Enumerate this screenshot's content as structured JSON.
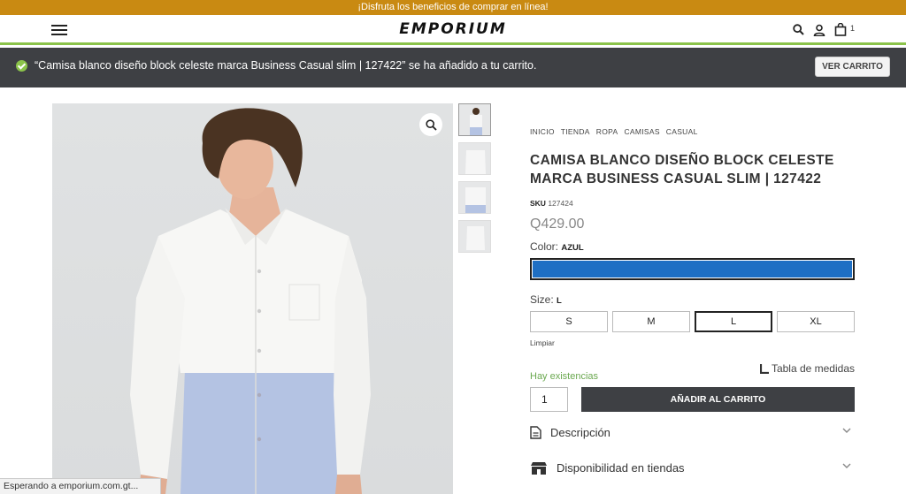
{
  "promo": {
    "text": "¡Disfruta los beneficios de comprar en línea!"
  },
  "header": {
    "logo": "EMPORIUM",
    "cart_count": "1"
  },
  "notice": {
    "message": "“Camisa blanco diseño block celeste marca Business Casual slim | 127422” se ha añadido a tu carrito.",
    "button_label": "VER CARRITO"
  },
  "breadcrumb": [
    "INICIO",
    "TIENDA",
    "ROPA",
    "CAMISAS",
    "CASUAL"
  ],
  "product": {
    "title": "CAMISA BLANCO DISEÑO BLOCK CELESTE MARCA BUSINESS CASUAL SLIM | 127422",
    "sku_label": "SKU",
    "sku": "127424",
    "price": "Q429.00",
    "color_label": "Color:",
    "color_value": "AZUL",
    "color_hex": "#1e6fc4",
    "size_label": "Size:",
    "size_value": "L",
    "sizes": [
      "S",
      "M",
      "L",
      "XL"
    ],
    "clear_label": "Limpiar",
    "size_chart_label": "Tabla de medidas",
    "stock": "Hay existencias",
    "quantity": "1",
    "add_to_cart": "AÑADIR AL CARRITO",
    "accordion": [
      "Descripción",
      "Disponibilidad en tiendas"
    ]
  },
  "status_bar": {
    "text": "Esperando a emporium.com.gt..."
  }
}
